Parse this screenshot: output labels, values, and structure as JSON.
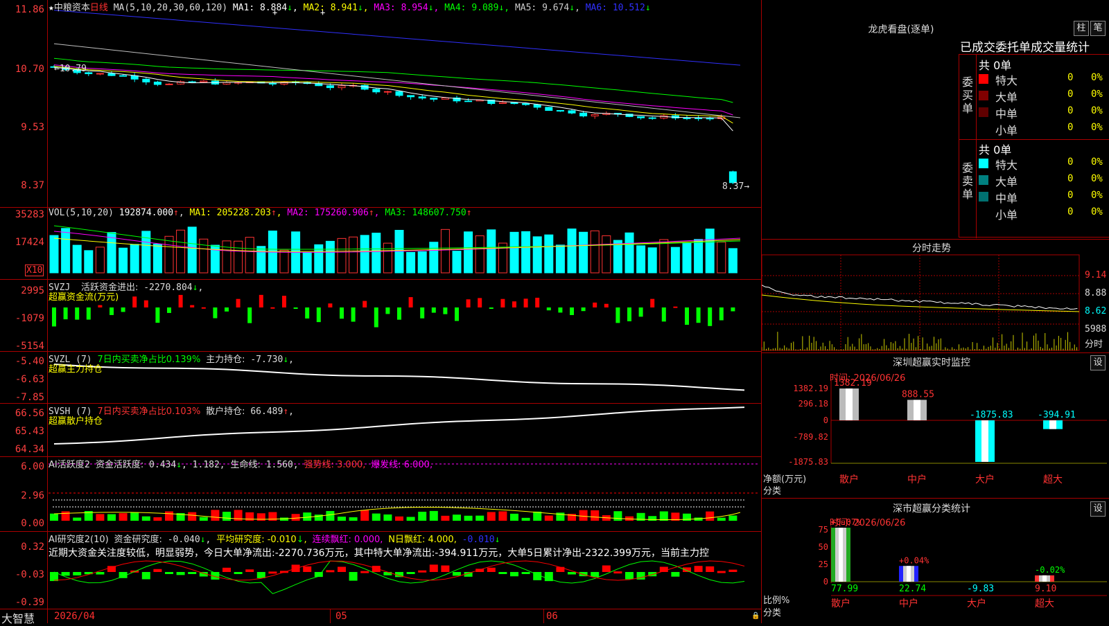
{
  "colors": {
    "up": "#ff3232",
    "down": "#00ffff",
    "ma1": "#ffffff",
    "ma2": "#ffff00",
    "ma3": "#ff00ff",
    "ma4": "#00ff00",
    "ma5": "#c0c0c0",
    "ma6": "#3030ff"
  },
  "kline": {
    "stock": "中粮资本",
    "period": "日线",
    "ma_label": "MA(5,10,20,30,60,120)",
    "ma": [
      {
        "name": "MA1:",
        "value": "8.884",
        "arrow": "↓"
      },
      {
        "name": "MA2:",
        "value": "8.941",
        "arrow": "↓"
      },
      {
        "name": "MA3:",
        "value": "8.954",
        "arrow": "↓"
      },
      {
        "name": "MA4:",
        "value": "9.089",
        "arrow": "↓"
      },
      {
        "name": "MA5:",
        "value": "9.674",
        "arrow": "↓"
      },
      {
        "name": "MA6:",
        "value": "10.512",
        "arrow": "↓"
      }
    ],
    "y_ticks": [
      "11.86",
      "10.70",
      "9.53",
      "8.37"
    ],
    "high_label": "10.79",
    "low_label": "8.37"
  },
  "vol": {
    "label": "VOL(5,10,20)",
    "value": "192874.000",
    "ma": [
      {
        "name": "MA1:",
        "value": "205228.203"
      },
      {
        "name": "MA2:",
        "value": "175260.906"
      },
      {
        "name": "MA3:",
        "value": "148607.750"
      }
    ],
    "y_ticks": [
      "35283",
      "17424"
    ],
    "unit": "X10"
  },
  "svzj": {
    "label": "SVZJ",
    "text": "活跃资金进出:",
    "value": "-2270.804",
    "tail": ",",
    "sub": "超赢资金流(万元)",
    "y_ticks": [
      "2995",
      "-1079",
      "-5154"
    ]
  },
  "svzl": {
    "label": "SVZL (7)",
    "text": "7日内买卖净占比0.139%",
    "main": "主力持仓:",
    "value": "-7.730",
    "sub": "超赢主力持仓",
    "y_ticks": [
      "-5.40",
      "-6.63",
      "-7.85"
    ]
  },
  "svsh": {
    "label": "SVSH (7)",
    "text": "7日内买卖净占比0.103%",
    "main": "散户持仓:",
    "value": "66.489",
    "sub": "超赢散户持仓",
    "y_ticks": [
      "66.56",
      "65.43",
      "64.34"
    ]
  },
  "ai1": {
    "label": "AI活跃度2",
    "t1": "资金活跃度:",
    "v1": "0.434",
    "v2": "1.182,",
    "t3": "生命线:",
    "v3": "1.560,",
    "t4": "强势线:",
    "v4": "3.000,",
    "t5": "爆发线:",
    "v5": "6.000,",
    "y_ticks": [
      "6.00",
      "2.96",
      "0.00"
    ]
  },
  "ai2": {
    "label": "AI研究度2(10)",
    "t1": "资金研究度:",
    "v1": "-0.040",
    "t2": "平均研究度:",
    "v2": "-0.010",
    "t3": "连续飘红:",
    "v3": "0.000,",
    "t4": "N日飘红:",
    "v4": "4.000,",
    "v5": "-0.010",
    "desc": "近期大资金关注度较低，明显弱势，今日大单净流出:-2270.736万元，其中特大单净流出:-394.911万元，大单5日累计净出-2322.399万元，当前主力控",
    "y_ticks": [
      "0.32",
      "-0.03",
      "-0.39"
    ]
  },
  "xaxis": {
    "brand": "大智慧",
    "dates": [
      "2026/04",
      "05",
      "06"
    ]
  },
  "longhu": {
    "title": "龙虎看盘(逐单)",
    "btn1": "柱",
    "btn2": "笔",
    "header": "已成交委托单成交量统计",
    "buy": {
      "side": "委买单",
      "total": "共 0单",
      "rows": [
        {
          "name": "特大",
          "vol": "0",
          "pct": "0%",
          "color": "#ff0000"
        },
        {
          "name": "大单",
          "vol": "0",
          "pct": "0%",
          "color": "#800000"
        },
        {
          "name": "中单",
          "vol": "0",
          "pct": "0%",
          "color": "#600000"
        },
        {
          "name": "小单",
          "vol": "0",
          "pct": "0%",
          "color": ""
        }
      ]
    },
    "sell": {
      "side": "委卖单",
      "total": "共 0单",
      "rows": [
        {
          "name": "特大",
          "vol": "0",
          "pct": "0%",
          "color": "#00ffff"
        },
        {
          "name": "大单",
          "vol": "0",
          "pct": "0%",
          "color": "#008080"
        },
        {
          "name": "中单",
          "vol": "0",
          "pct": "0%",
          "color": "#007070"
        },
        {
          "name": "小单",
          "vol": "0",
          "pct": "0%",
          "color": ""
        }
      ]
    }
  },
  "fenshi": {
    "title": "分时走势",
    "y_ticks": [
      "9.14",
      "8.88",
      "8.62"
    ],
    "vol_tick": "5988",
    "vol_unit": "分时"
  },
  "monitor": {
    "title": "深圳超赢实时监控",
    "btn": "设",
    "time": "时间: 2026/06/26",
    "y_ticks": [
      "1382.19",
      "296.18",
      "0",
      "-789.82",
      "-1875.83"
    ],
    "axis_label": "净额(万元)",
    "x_label": "分类",
    "bars": [
      {
        "name": "散户",
        "value": 1382.19,
        "label": "1382.19"
      },
      {
        "name": "中户",
        "value": 888.55,
        "label": "888.55"
      },
      {
        "name": "大户",
        "value": -1875.83,
        "label": "-1875.83"
      },
      {
        "name": "超大",
        "value": -394.91,
        "label": "-394.91"
      }
    ]
  },
  "classify": {
    "title": "深市超赢分类统计",
    "btn": "设",
    "time": "时间: 2026/06/26",
    "y_ticks": [
      "75",
      "50",
      "25",
      "0"
    ],
    "axis_label": "比例%",
    "x_label": "分类",
    "bars": [
      {
        "name": "散户",
        "pct": "+0.07%",
        "value": 77.99,
        "label": "77.99"
      },
      {
        "name": "中户",
        "pct": "+0.04%",
        "value": 22.74,
        "label": "22.74"
      },
      {
        "name": "大户",
        "pct": "",
        "value": -9.83,
        "label": "-9.83"
      },
      {
        "name": "超大",
        "pct": "-0.02%",
        "value": 9.1,
        "label": "9.10"
      }
    ]
  }
}
